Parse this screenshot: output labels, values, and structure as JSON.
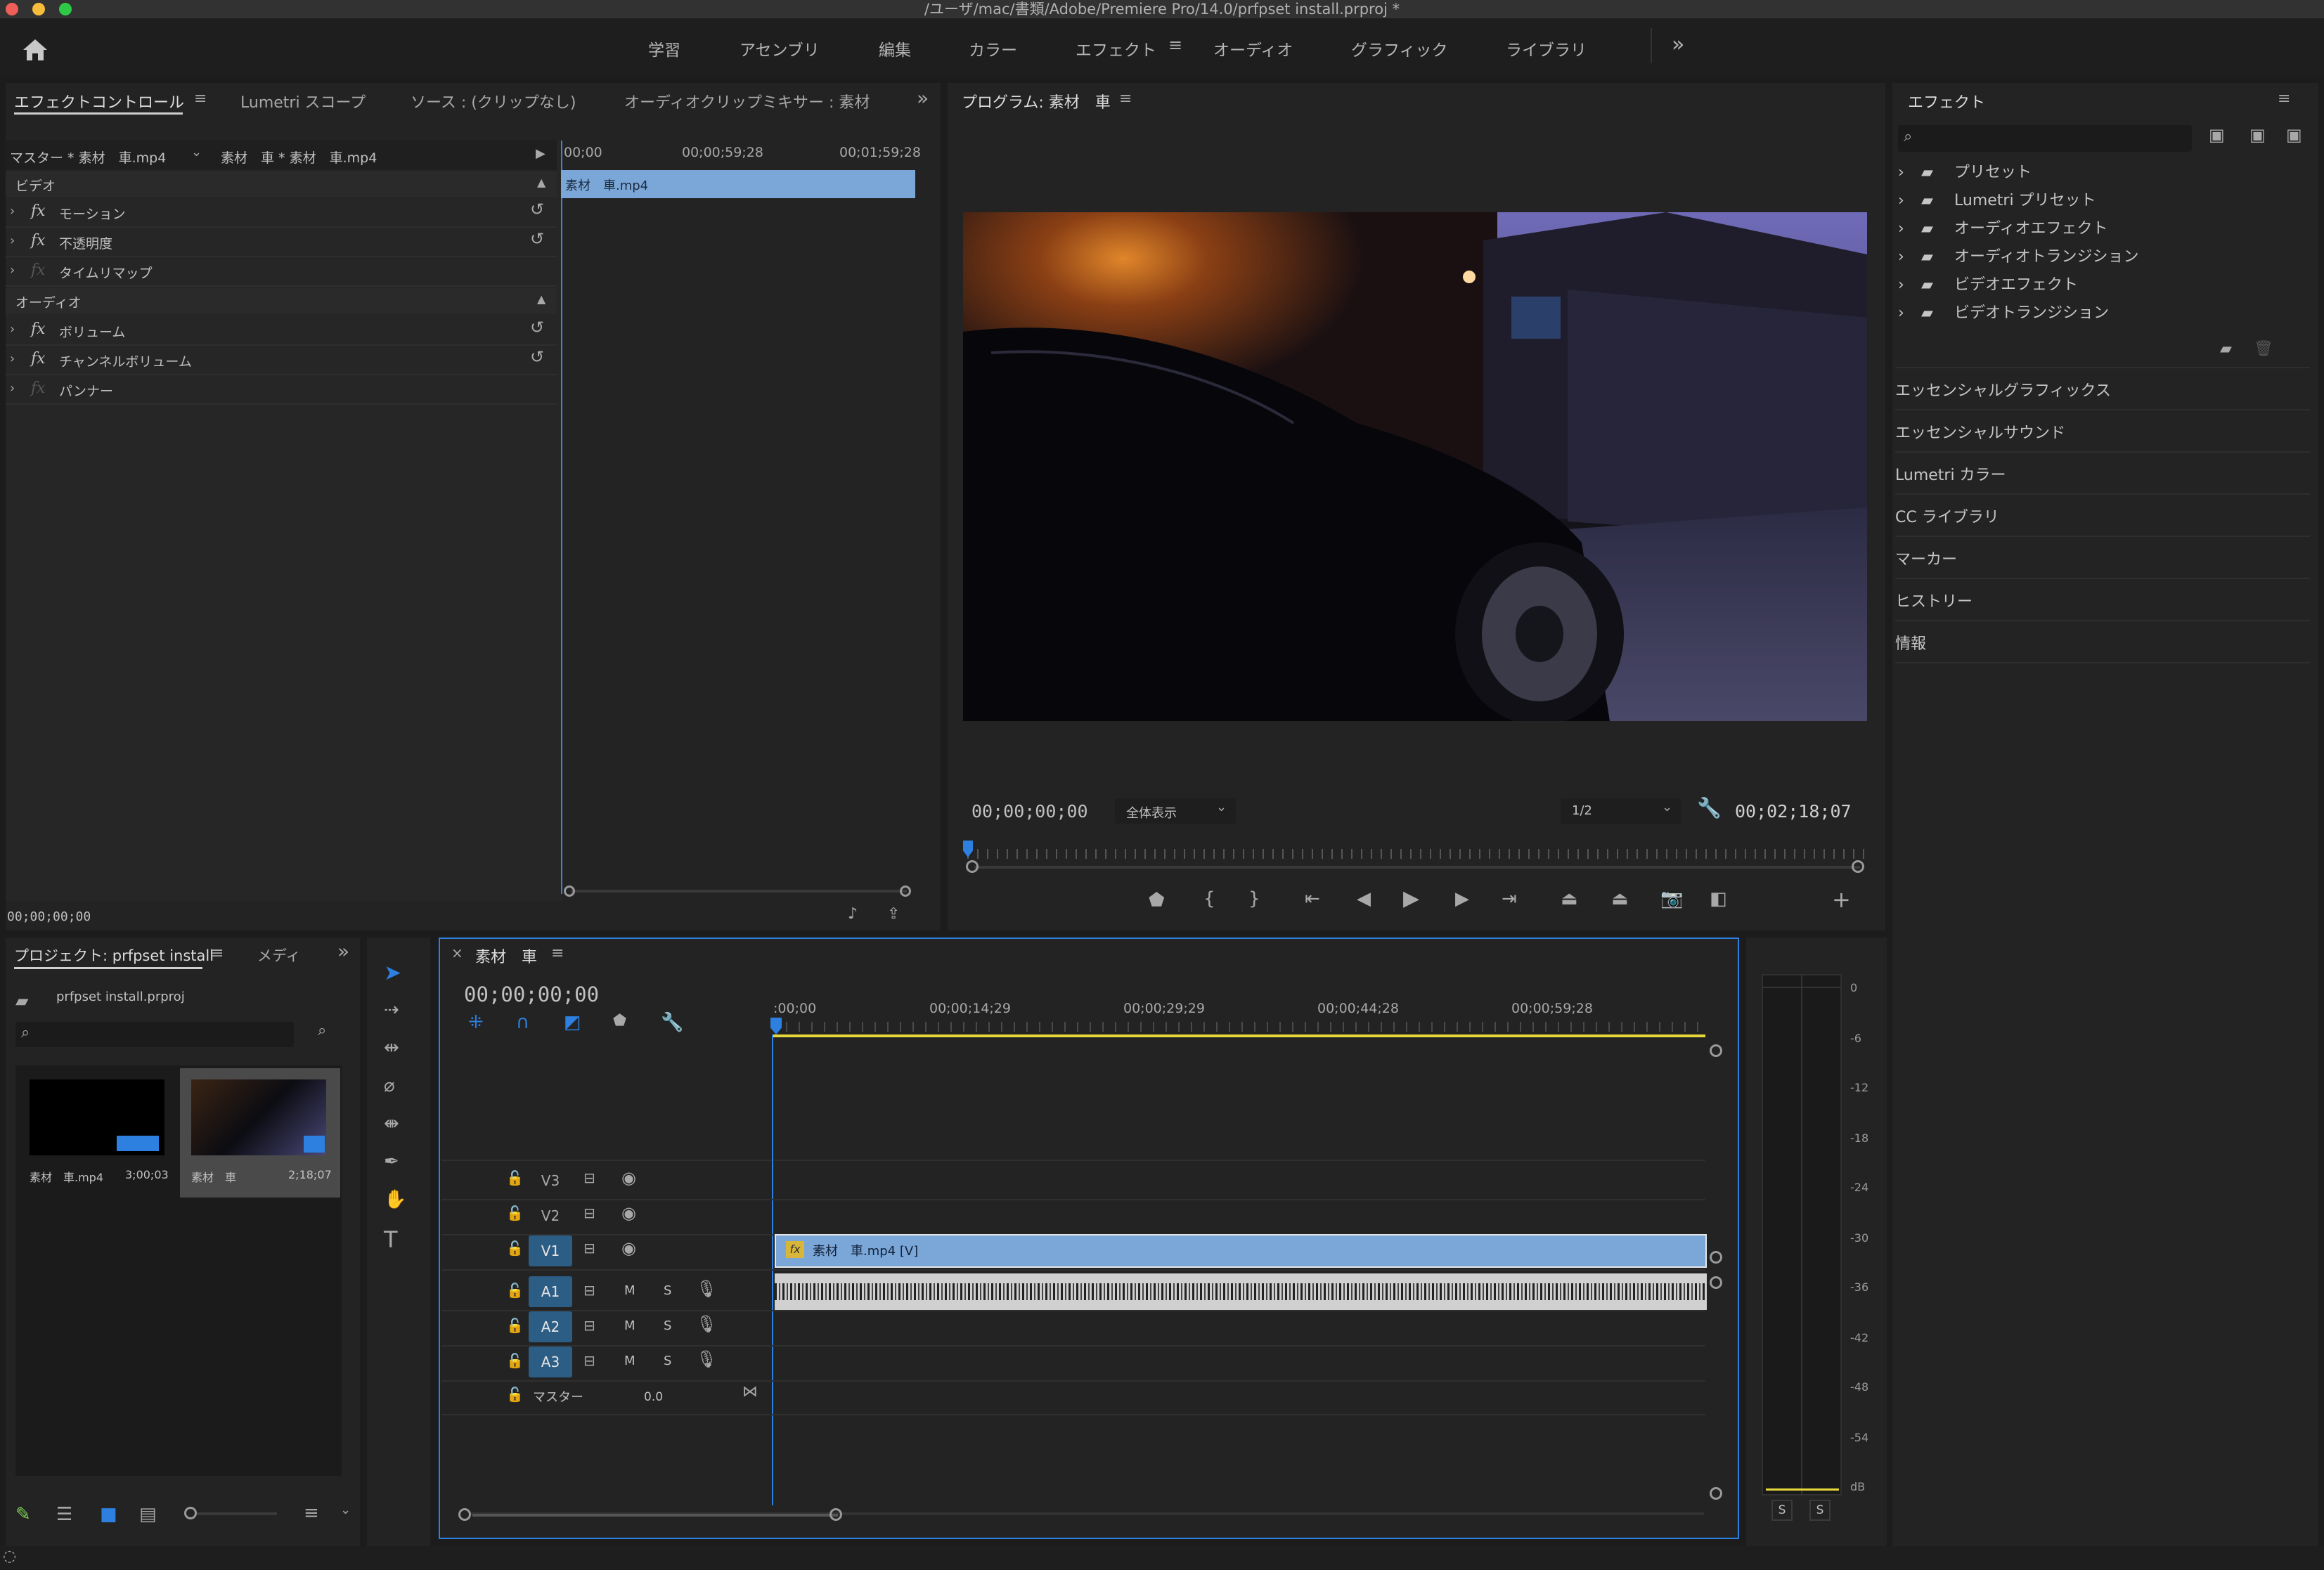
{
  "window": {
    "title": "/ユーザ/mac/書類/Adobe/Premiere Pro/14.0/prfpset install.prproj *"
  },
  "workspaces": {
    "items": [
      "学習",
      "アセンブリ",
      "編集",
      "カラー",
      "エフェクト",
      "オーディオ",
      "グラフィック",
      "ライブラリ"
    ],
    "active": "エフェクト",
    "more": "»"
  },
  "effect_controls": {
    "tabs": [
      "エフェクトコントロール",
      "Lumetri スコープ",
      "ソース : (クリップなし)",
      "オーディオクリップミキサー : 素材"
    ],
    "master_label": "マスター * 素材　車.mp4",
    "clip_label": "素材　車 * 素材　車.mp4",
    "ruler": [
      "00;00",
      "00;00;59;28",
      "00;01;59;28"
    ],
    "clip_bar": "素材　車.mp4",
    "sections": {
      "video": "ビデオ",
      "audio": "オーディオ"
    },
    "video_rows": [
      "モーション",
      "不透明度",
      "タイムリマップ"
    ],
    "audio_rows": [
      "ボリューム",
      "チャンネルボリューム",
      "パンナー"
    ],
    "timecode": "00;00;00;00"
  },
  "program_monitor": {
    "title": "プログラム: 素材　車",
    "timecode_in": "00;00;00;00",
    "zoom": "全体表示",
    "resolution": "1/2",
    "duration": "00;02;18;07"
  },
  "effects_panel": {
    "title": "エフェクト",
    "search_placeholder": "",
    "tree": [
      "プリセット",
      "Lumetri プリセット",
      "オーディオエフェクト",
      "オーディオトランジション",
      "ビデオエフェクト",
      "ビデオトランジション"
    ],
    "side_panels": [
      "エッセンシャルグラフィックス",
      "エッセンシャルサウンド",
      "Lumetri カラー",
      "CC ライブラリ",
      "マーカー",
      "ヒストリー",
      "情報"
    ]
  },
  "project_panel": {
    "tabs": [
      "プロジェクト: prfpset install",
      "メディ"
    ],
    "file": "prfpset install.prproj",
    "items": [
      {
        "name": "素材　車.mp4",
        "duration": "3;00;03"
      },
      {
        "name": "素材　車",
        "duration": "2;18;07"
      }
    ]
  },
  "timeline": {
    "tab": "素材　車",
    "timecode": "00;00;00;00",
    "ruler": [
      ":00;00",
      "00;00;14;29",
      "00;00;29;29",
      "00;00;44;28",
      "00;00;59;28"
    ],
    "video_tracks": [
      "V3",
      "V2",
      "V1"
    ],
    "audio_tracks": [
      "A1",
      "A2",
      "A3"
    ],
    "master": {
      "label": "マスター",
      "value": "0.0"
    },
    "clip_label": "素材　車.mp4 [V]",
    "mute_label": "M",
    "solo_label": "S"
  },
  "audio_meter": {
    "scale": [
      "0",
      "-6",
      "-12",
      "-18",
      "-24",
      "-30",
      "-36",
      "-42",
      "-48",
      "-54",
      "dB"
    ],
    "solo_buttons": [
      "S",
      "S"
    ]
  },
  "colors": {
    "accent": "#3b8fdf",
    "clip_video": "#7ba7d8",
    "playhead": "#2d7fe0",
    "work_area": "#e6d83a"
  }
}
